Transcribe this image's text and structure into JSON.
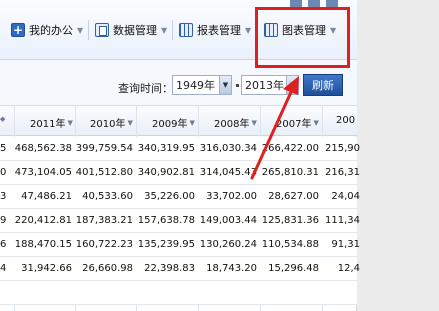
{
  "toolbar": {
    "items": [
      {
        "label": "我的办公",
        "icon": "plus-icon"
      },
      {
        "label": "数据管理",
        "icon": "document-icon"
      },
      {
        "label": "报表管理",
        "icon": "table-icon"
      },
      {
        "label": "图表管理",
        "icon": "chart-grid-icon"
      }
    ]
  },
  "query": {
    "label": "查询时间：",
    "start_year": "1949年",
    "end_year": "2013年",
    "refresh_label": "刷新"
  },
  "table": {
    "headers": [
      "2011年",
      "2010年",
      "2009年",
      "2008年",
      "2007年",
      "200"
    ],
    "lead": [
      "5",
      "0",
      "3",
      "9",
      "6",
      "4",
      ""
    ],
    "rows": [
      [
        "468,562.38",
        "399,759.54",
        "340,319.95",
        "316,030.34",
        "266,422.00",
        "215,90"
      ],
      [
        "473,104.05",
        "401,512.80",
        "340,902.81",
        "314,045.43",
        "265,810.31",
        "216,31"
      ],
      [
        "47,486.21",
        "40,533.60",
        "35,226.00",
        "33,702.00",
        "28,627.00",
        "24,04"
      ],
      [
        "220,412.81",
        "187,383.21",
        "157,638.78",
        "149,003.44",
        "125,831.36",
        "111,34"
      ],
      [
        "188,470.15",
        "160,722.23",
        "135,239.95",
        "130,260.24",
        "110,534.88",
        "91,31"
      ],
      [
        "31,942.66",
        "26,660.98",
        "22,398.83",
        "18,743.20",
        "15,296.48",
        "12,4"
      ],
      [
        "",
        "",
        "",
        "",
        "",
        ""
      ]
    ]
  },
  "colors": {
    "highlight": "#e02020",
    "refresh_button": "#2f64b5",
    "toolbar_bg": "#eaf1fb"
  }
}
